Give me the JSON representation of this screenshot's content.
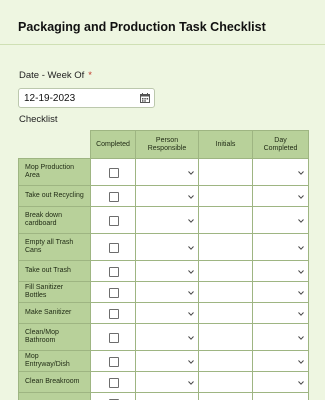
{
  "form": {
    "title": "Packaging and Production Task Checklist",
    "date_label": "Date - Week Of",
    "required_mark": "*",
    "date_value": "12-19-2023",
    "checklist_label": "Checklist"
  },
  "table": {
    "columns": [
      "Completed",
      "Person Responsible",
      "Initials",
      "Day Completed"
    ],
    "rows": [
      "Mop Production Area",
      "Take out Recycling",
      "Break down cardboard",
      "Empty all Trash Cans",
      "Take out Trash",
      "Fill Sanitizer Bottles",
      "Make Sanitizer",
      "Clean/Mop Bathroom",
      "Mop Entryway/Dish",
      "Clean Breakroom",
      ""
    ]
  },
  "icons": {
    "date": "calendar-icon",
    "dropdown": "chevron-down-icon",
    "checkbox": "checkbox"
  },
  "colors": {
    "background": "#eef6e1",
    "header_fill": "#b8d19a",
    "border": "#9eb582"
  }
}
